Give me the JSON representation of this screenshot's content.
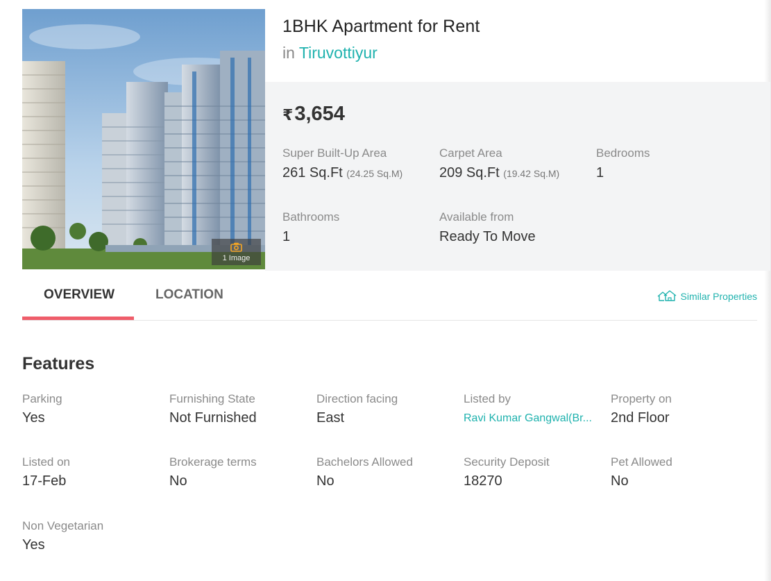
{
  "listing": {
    "title": "1BHK Apartment for Rent",
    "location_prefix": "in",
    "location": "Tiruvottiyur",
    "image_count_label": "1 Image"
  },
  "price": {
    "currency_symbol": "₹",
    "amount": "3,654"
  },
  "specs": {
    "super_builtup": {
      "label": "Super Built-Up Area",
      "value": "261 Sq.Ft",
      "sub": "(24.25 Sq.M)"
    },
    "carpet": {
      "label": "Carpet Area",
      "value": "209 Sq.Ft",
      "sub": "(19.42 Sq.M)"
    },
    "bedrooms": {
      "label": "Bedrooms",
      "value": "1"
    },
    "bathrooms": {
      "label": "Bathrooms",
      "value": "1"
    },
    "available": {
      "label": "Available from",
      "value": "Ready To Move"
    }
  },
  "tabs": {
    "overview": "OVERVIEW",
    "location": "LOCATION",
    "similar": "Similar Properties"
  },
  "features": {
    "title": "Features",
    "items": [
      {
        "label": "Parking",
        "value": "Yes"
      },
      {
        "label": "Furnishing State",
        "value": "Not Furnished"
      },
      {
        "label": "Direction facing",
        "value": "East"
      },
      {
        "label": "Listed by",
        "value": "Ravi Kumar Gangwal(Br..."
      },
      {
        "label": "Property on",
        "value": "2nd Floor"
      },
      {
        "label": "Listed on",
        "value": "17-Feb"
      },
      {
        "label": "Brokerage terms",
        "value": "No"
      },
      {
        "label": "Bachelors Allowed",
        "value": "No"
      },
      {
        "label": "Security Deposit",
        "value": "18270"
      },
      {
        "label": "Pet Allowed",
        "value": "No"
      },
      {
        "label": "Non Vegetarian",
        "value": "Yes"
      }
    ]
  },
  "colors": {
    "accent_teal": "#1fb2ae",
    "tab_underline": "#ef5d6a",
    "details_bg": "#f3f4f5"
  },
  "icons": {
    "camera": "camera-icon",
    "similar": "homes-outline-icon"
  }
}
